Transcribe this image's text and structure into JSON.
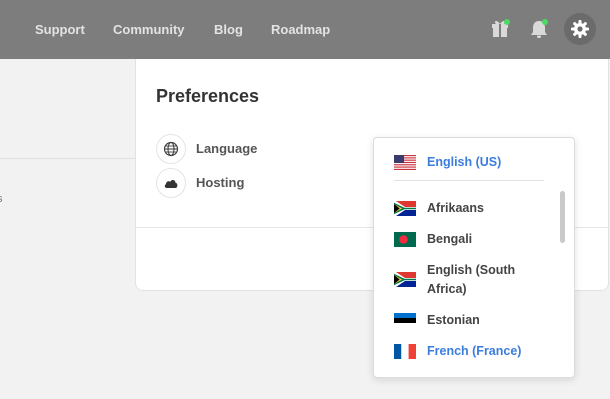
{
  "nav": {
    "links": [
      "Support",
      "Community",
      "Blog",
      "Roadmap"
    ]
  },
  "icons": {
    "gift": "gift-icon",
    "bell": "bell-icon",
    "settings": "gear-icon",
    "globe": "globe-icon",
    "cloud": "cloud-icon"
  },
  "colors": {
    "topbar": "#7d7d7d",
    "notification_dot": "#4cd964",
    "accent": "#3b7ddd"
  },
  "left_panel": {
    "fragment": "s"
  },
  "preferences": {
    "title": "Preferences",
    "items": [
      {
        "label": "Language",
        "icon": "globe-icon"
      },
      {
        "label": "Hosting",
        "icon": "cloud-icon"
      }
    ]
  },
  "language_dropdown": {
    "selected": {
      "label": "English (US)",
      "flag": "us-flag"
    },
    "options": [
      {
        "label": "Afrikaans",
        "flag": "south-africa-flag"
      },
      {
        "label": "Bengali",
        "flag": "bangladesh-flag"
      },
      {
        "label": "English (South Africa)",
        "flag": "south-africa-flag"
      },
      {
        "label": "Estonian",
        "flag": "estonia-flag"
      },
      {
        "label": "French (France)",
        "flag": "france-flag",
        "highlighted": true
      }
    ]
  }
}
